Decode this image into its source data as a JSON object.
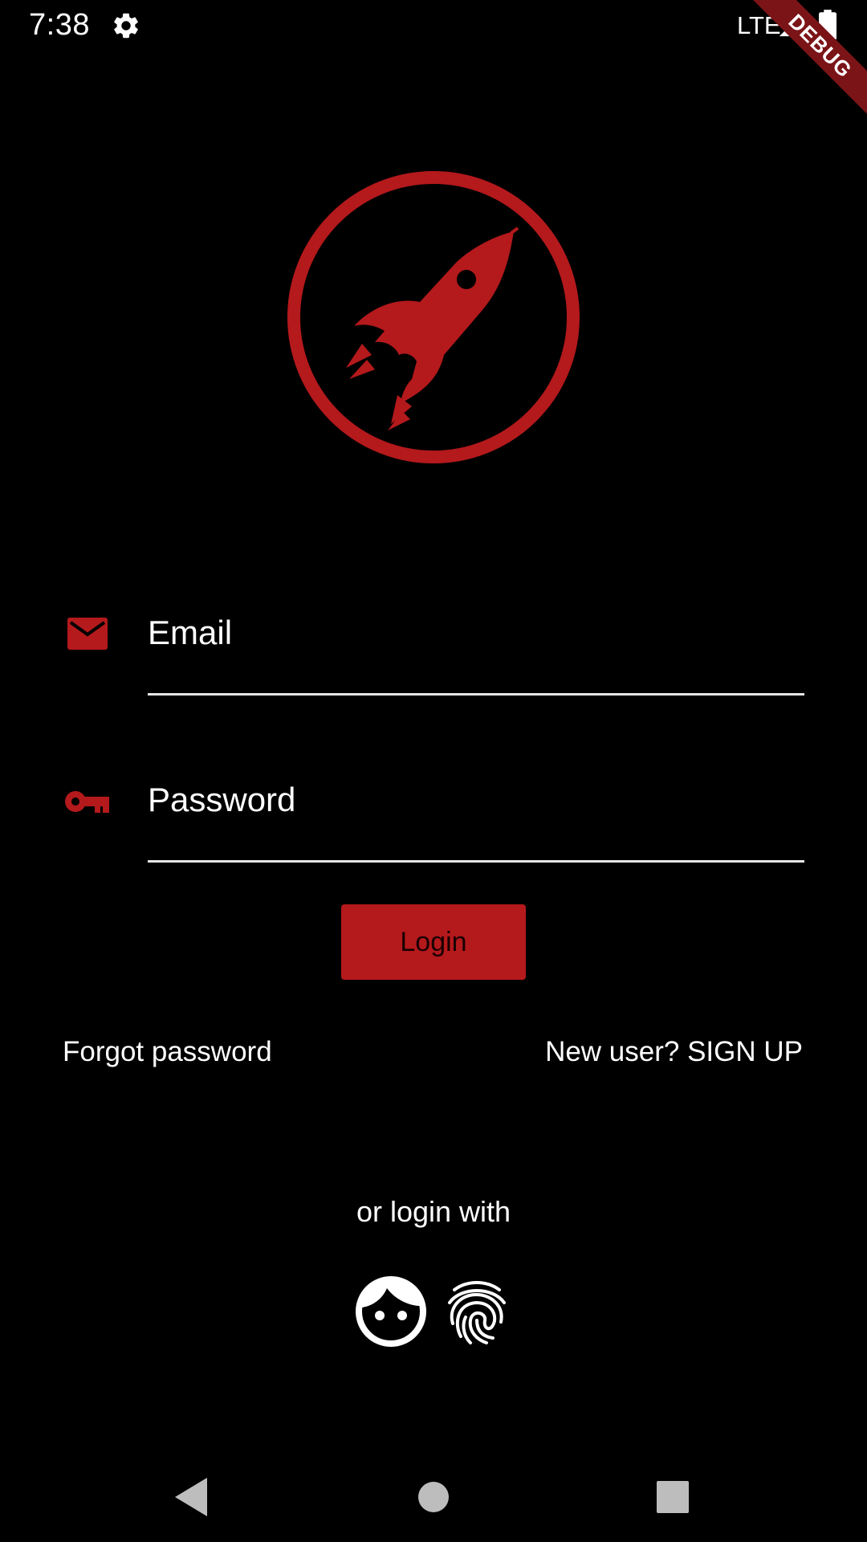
{
  "status_bar": {
    "time": "7:38",
    "network": "LTE"
  },
  "debug_banner": {
    "label": "DEBUG"
  },
  "login_form": {
    "email_placeholder": "Email",
    "password_placeholder": "Password",
    "login_label": "Login",
    "forgot_password_label": "Forgot password",
    "signup_label": "New user? SIGN UP",
    "alt_login_label": "or login with"
  },
  "icons": {
    "logo": "rocket-icon",
    "email": "mail-icon",
    "password": "key-icon",
    "face": "face-icon",
    "fingerprint": "fingerprint-icon",
    "settings": "gear-icon",
    "nav_back": "back-triangle-icon",
    "nav_home": "home-circle-icon",
    "nav_recents": "recents-square-icon"
  },
  "colors": {
    "accent": "#b4191c",
    "background": "#000000",
    "text": "#ffffff",
    "debug_ribbon": "#7b1417"
  }
}
